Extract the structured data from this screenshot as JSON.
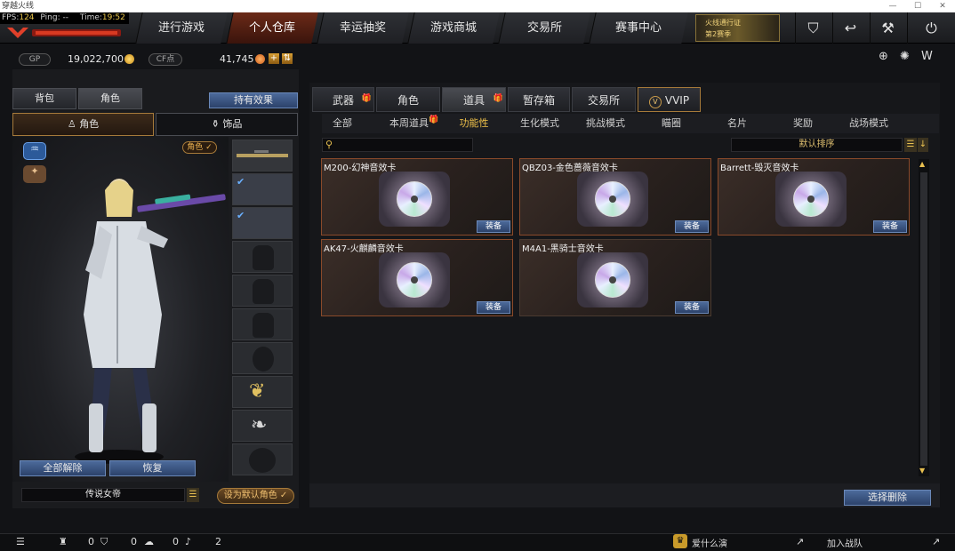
{
  "window": {
    "title": "穿越火线"
  },
  "hud": {
    "fps_label": "FPS:",
    "fps_value": "124",
    "ping_label": "Ping: --",
    "time_label": "Time:",
    "time_value": "19:52"
  },
  "nav": {
    "tabs": [
      {
        "label": "进行游戏"
      },
      {
        "label": "个人仓库",
        "active": true
      },
      {
        "label": "幸运抽奖"
      },
      {
        "label": "游戏商城"
      },
      {
        "label": "交易所"
      },
      {
        "label": "赛事中心"
      }
    ],
    "promo_line1": "火线通行证",
    "promo_line2": "第2赛季"
  },
  "currency": {
    "gp_label": "GP",
    "gp_value": "19,022,700",
    "cf_label": "CF点",
    "cf_value": "41,745"
  },
  "left": {
    "tabs": [
      "背包",
      "角色"
    ],
    "effects_button": "持有效果",
    "subtabs": [
      "角色",
      "饰品"
    ],
    "role_badge": "角色",
    "unequip_all": "全部解除",
    "restore": "恢复",
    "character_name": "传说女帝",
    "set_default": "设为默认角色"
  },
  "right": {
    "categories": [
      {
        "label": "武器",
        "gift": true
      },
      {
        "label": "角色",
        "gift": false
      },
      {
        "label": "道具",
        "gift": true,
        "active": true
      },
      {
        "label": "暂存箱",
        "gift": false
      },
      {
        "label": "交易所",
        "gift": false
      },
      {
        "label": "VVIP",
        "gift": false
      }
    ],
    "subtabs": [
      {
        "label": "全部"
      },
      {
        "label": "本周道具",
        "gift": true
      },
      {
        "label": "功能性",
        "active": true
      },
      {
        "label": "生化模式"
      },
      {
        "label": "挑战模式"
      },
      {
        "label": "瞄圈"
      },
      {
        "label": "名片"
      },
      {
        "label": "奖励"
      },
      {
        "label": "战场模式"
      }
    ],
    "search_placeholder": "",
    "sort_label": "默认排序",
    "items": [
      {
        "name": "M200-幻神音效卡",
        "equip": "装备"
      },
      {
        "name": "QBZ03-金色蔷薇音效卡",
        "equip": "装备"
      },
      {
        "name": "Barrett-毁灭音效卡",
        "equip": "装备"
      },
      {
        "name": "AK47-火麒麟音效卡",
        "equip": "装备"
      },
      {
        "name": "M4A1-黑骑士音效卡",
        "equip": "装备"
      }
    ],
    "delete_button": "选择删除"
  },
  "bottom": {
    "count1": "0",
    "count2": "0",
    "count3": "0",
    "count4": "2",
    "stream_label": "爱什么演",
    "join_team": "加入战队"
  },
  "colors": {
    "accent_orange": "#8a4a2a",
    "equip_blue": "#2c426a",
    "active_yellow": "#f0c24a"
  }
}
